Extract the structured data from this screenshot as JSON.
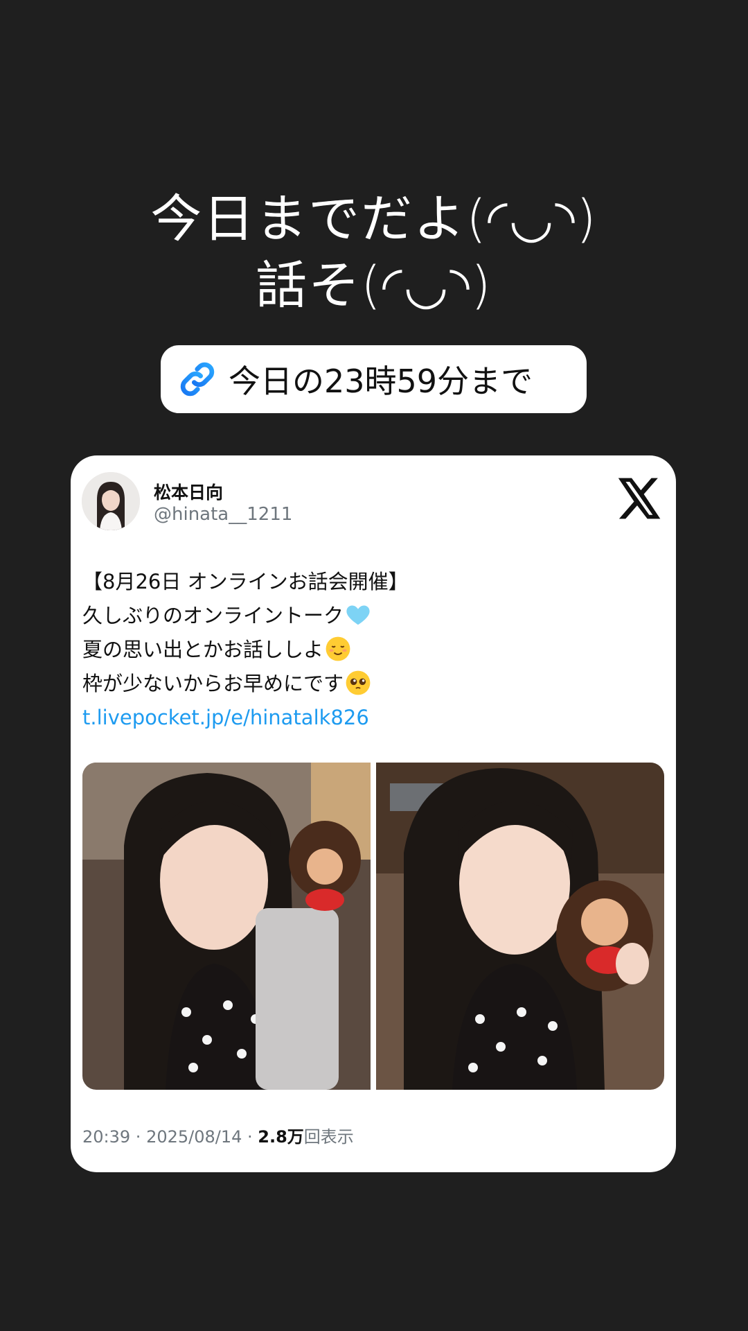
{
  "story": {
    "caption_line1": "今日までだよ(◜◡◝)",
    "caption_line2": "話そ(◜◡◝)",
    "link_sticker_label": "今日の23時59分まで"
  },
  "tweet": {
    "display_name": "松本日向",
    "handle": "@hinata__1211",
    "lines": [
      "【8月26日 オンラインお話会開催】",
      "久しぶりのオンライントーク",
      "夏の思い出とかお話ししよ",
      "枠が少ないからお早めにです"
    ],
    "link": "t.livepocket.jp/e/hinatalk826",
    "time": "20:39",
    "date": "2025/08/14",
    "views_count": "2.8万",
    "views_label": "回表示",
    "separator": " · "
  },
  "icons": {
    "link": "link-icon",
    "x_logo": "x-logo-icon",
    "heart_emoji": "light-blue-heart-emoji",
    "smile_emoji": "smiling-face-emoji",
    "plead_emoji": "pleading-face-emoji"
  },
  "colors": {
    "background": "#1f1f1f",
    "link": "#1d9bf0",
    "sticker_icon": "#1ea1f2"
  }
}
